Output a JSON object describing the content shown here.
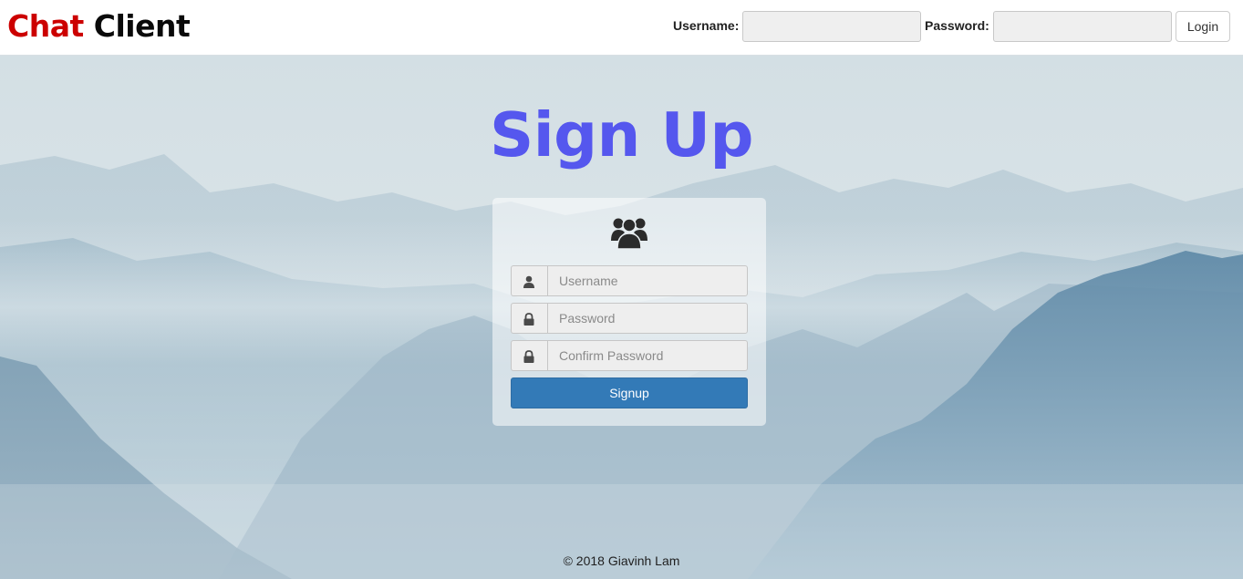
{
  "navbar": {
    "brand_first": "Chat",
    "brand_second": "Client",
    "username_label": "Username:",
    "password_label": "Password:",
    "username_value": "",
    "password_value": "",
    "login_label": "Login"
  },
  "signup": {
    "heading": "Sign Up",
    "panel_icon": "users-icon",
    "fields": [
      {
        "icon": "user-icon",
        "placeholder": "Username",
        "value": ""
      },
      {
        "icon": "lock-icon",
        "placeholder": "Password",
        "value": ""
      },
      {
        "icon": "lock-icon",
        "placeholder": "Confirm Password",
        "value": ""
      }
    ],
    "button_label": "Signup"
  },
  "footer": {
    "text": "© 2018 Giavinh Lam"
  },
  "colors": {
    "brand_accent": "#cc0000",
    "heading": "#5557ee",
    "primary_button": "#337ab7"
  }
}
